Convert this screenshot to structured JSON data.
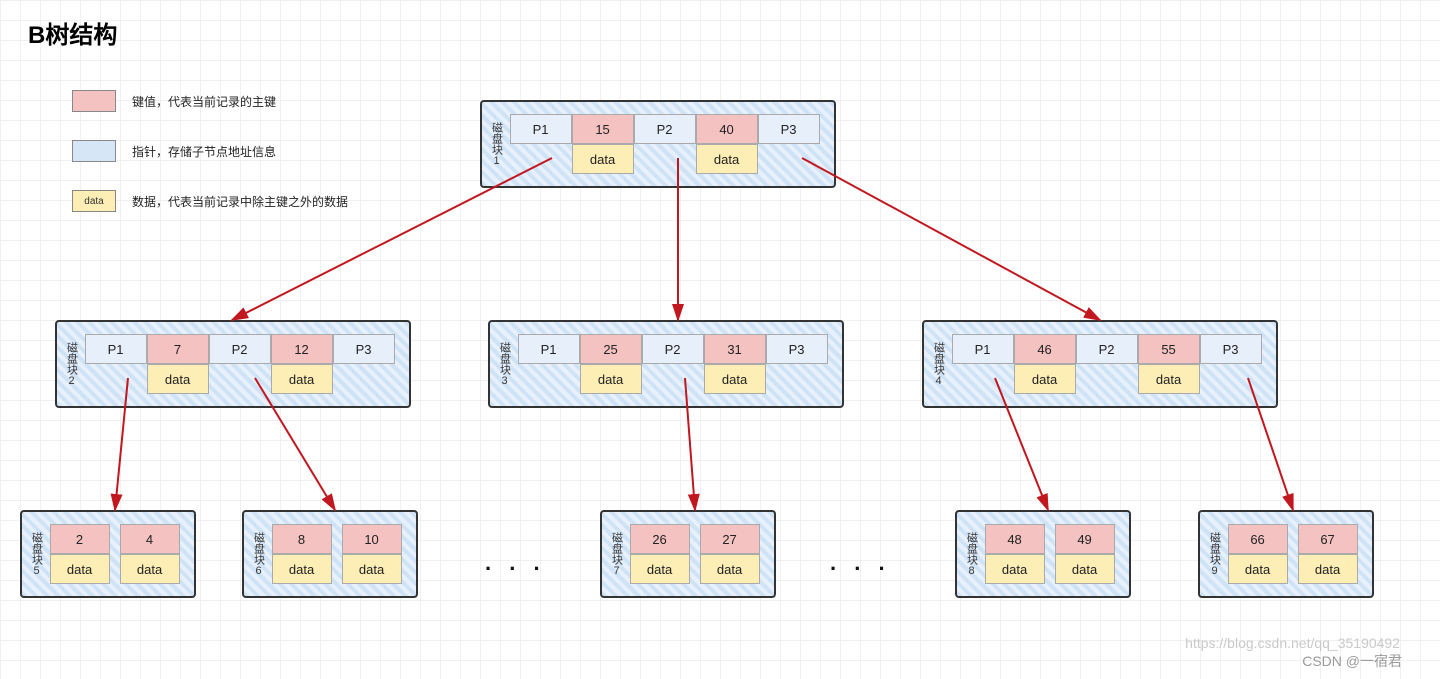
{
  "title": "B树结构",
  "legend": {
    "key_label": "键值，代表当前记录的主键",
    "ptr_label": "指针，存储子节点地址信息",
    "data_label": "数据，代表当前记录中除主键之外的数据",
    "data_swatch_text": "data"
  },
  "labels": {
    "block_prefix": "磁盘块",
    "ptr": [
      "P1",
      "P2",
      "P3"
    ],
    "data": "data"
  },
  "nodes": {
    "root": {
      "block_no": "1",
      "keys": [
        "15",
        "40"
      ]
    },
    "mid_l": {
      "block_no": "2",
      "keys": [
        "7",
        "12"
      ]
    },
    "mid_c": {
      "block_no": "3",
      "keys": [
        "25",
        "31"
      ]
    },
    "mid_r": {
      "block_no": "4",
      "keys": [
        "46",
        "55"
      ]
    }
  },
  "leaves": {
    "l5": {
      "block_no": "5",
      "keys": [
        "2",
        "4"
      ]
    },
    "l6": {
      "block_no": "6",
      "keys": [
        "8",
        "10"
      ]
    },
    "l7": {
      "block_no": "7",
      "keys": [
        "26",
        "27"
      ]
    },
    "l8": {
      "block_no": "8",
      "keys": [
        "48",
        "49"
      ]
    },
    "l9": {
      "block_no": "9",
      "keys": [
        "66",
        "67"
      ]
    }
  },
  "ellipsis": ". . .",
  "watermark": {
    "line1": "https://blog.csdn.net/qq_35190492",
    "line2": "CSDN @一宿君"
  }
}
